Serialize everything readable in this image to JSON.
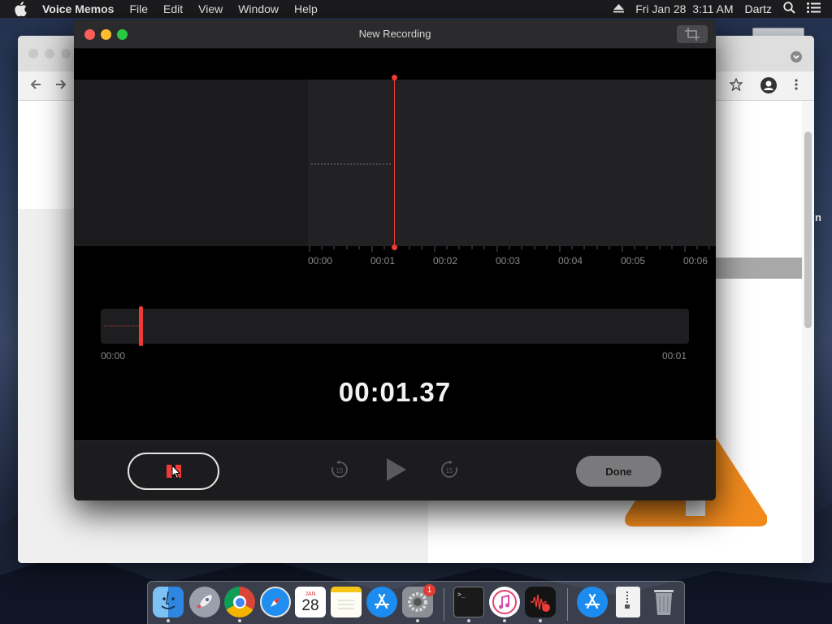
{
  "menubar": {
    "app_name": "Voice Memos",
    "menus": [
      "File",
      "Edit",
      "View",
      "Window",
      "Help"
    ],
    "datetime": "Fri Jan 28  3:11 AM",
    "user": "Dartz"
  },
  "browser": {
    "partial_text": "n"
  },
  "voice_memos": {
    "window_title": "New Recording",
    "ruler_labels": [
      "00:00",
      "00:01",
      "00:02",
      "00:03",
      "00:04",
      "00:05",
      "00:06"
    ],
    "overview": {
      "start_label": "00:00",
      "end_label": "00:01"
    },
    "timer": "00:01.37",
    "done_label": "Done",
    "skip_back_label": "15",
    "skip_forward_label": "15"
  },
  "dock": {
    "calendar_month": "JAN",
    "calendar_day": "28",
    "system_prefs_badge": "1",
    "apps": [
      "Finder",
      "Launchpad",
      "Chrome",
      "Safari",
      "Calendar",
      "Notes",
      "App Store",
      "System Preferences",
      "Terminal",
      "iTunes",
      "Voice Memos",
      "App Store Downloads",
      "Document",
      "Trash"
    ]
  },
  "colors": {
    "record_red": "#ef3b36",
    "window_bg": "#000000",
    "titlebar_bg": "#2b2b2d",
    "vlc_orange": "#f08a1d"
  }
}
